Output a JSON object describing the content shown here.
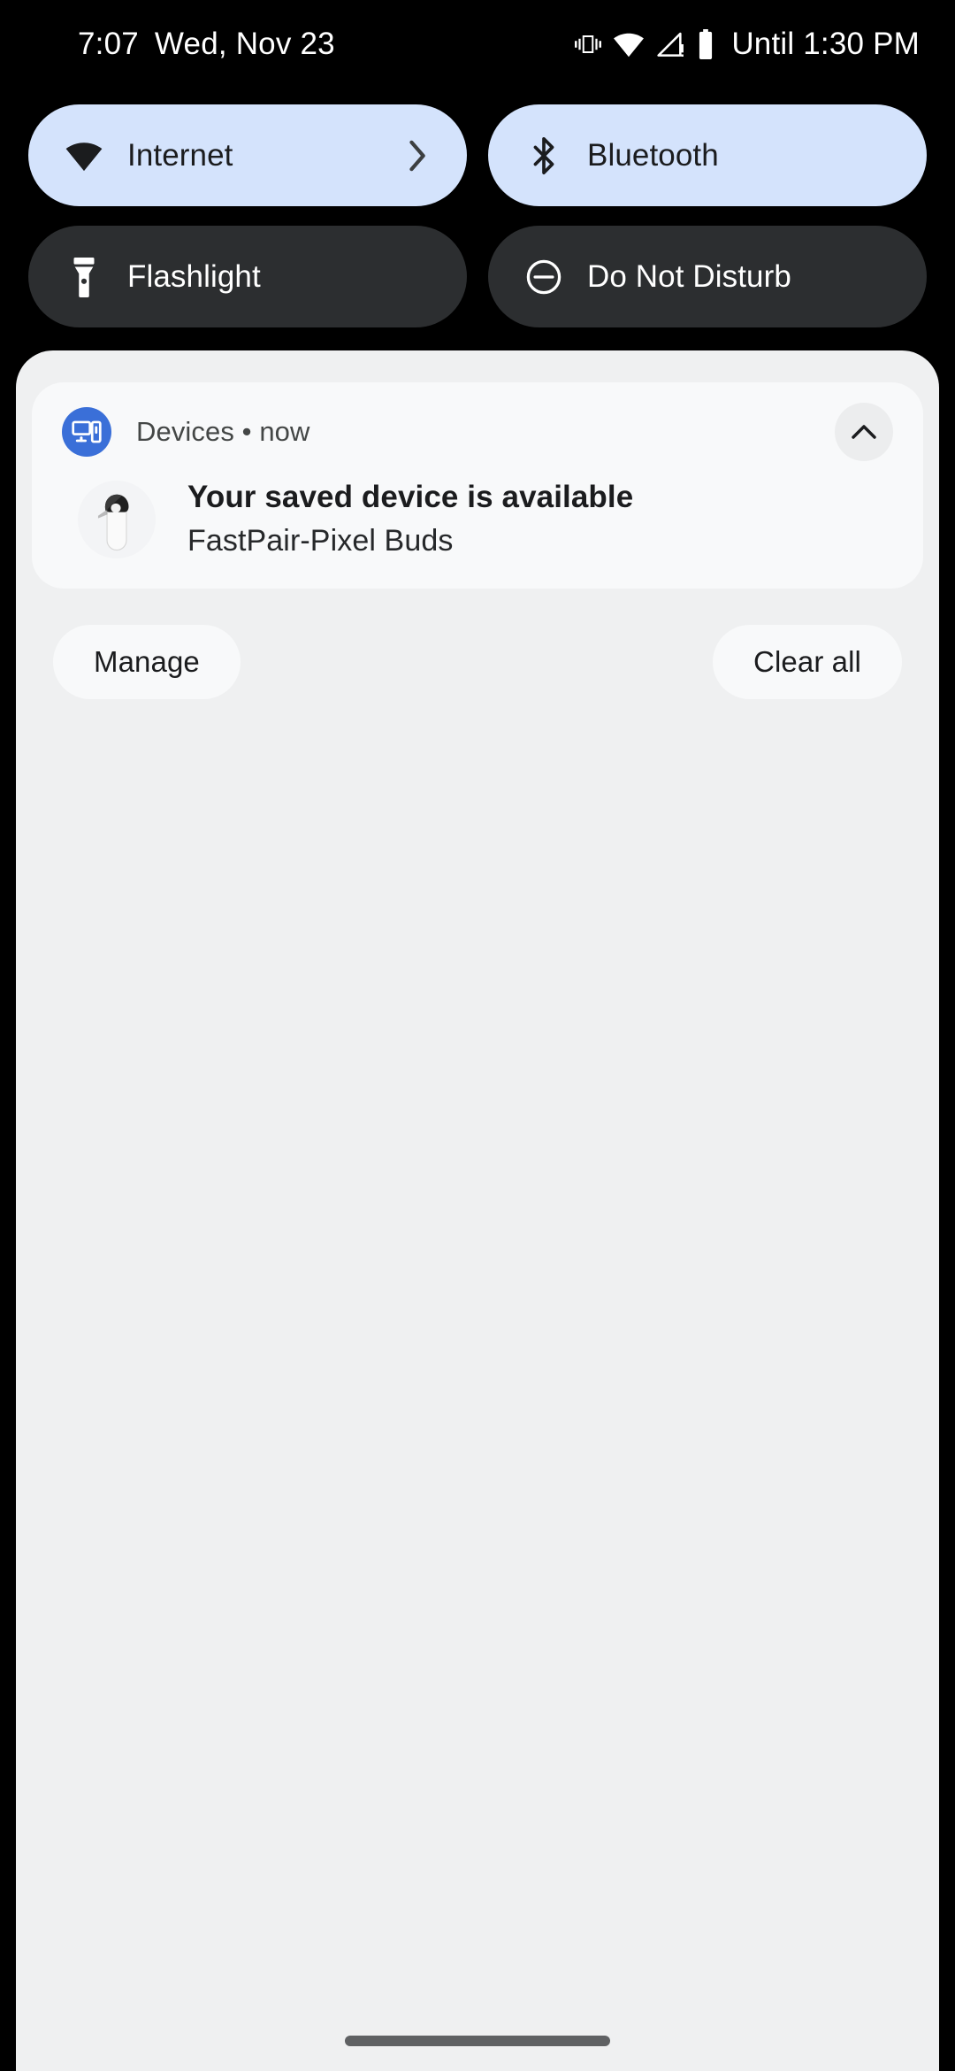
{
  "status_bar": {
    "time": "7:07",
    "date": "Wed, Nov 23",
    "icons": [
      "vibrate-icon",
      "wifi-icon",
      "signal-no-sim-icon",
      "battery-icon"
    ],
    "battery_text": "Until 1:30 PM"
  },
  "quick_settings": {
    "tiles": [
      {
        "label": "Internet",
        "icon": "wifi-icon",
        "state": "on",
        "has_chevron": true,
        "bg": "#D4E3FC",
        "fg": "#1B1C1E"
      },
      {
        "label": "Bluetooth",
        "icon": "bluetooth-icon",
        "state": "on",
        "has_chevron": false,
        "bg": "#D4E3FC",
        "fg": "#1B1C1E"
      },
      {
        "label": "Flashlight",
        "icon": "flashlight-icon",
        "state": "off",
        "has_chevron": false,
        "bg": "#2C2E30",
        "fg": "#FFFFFF"
      },
      {
        "label": "Do Not Disturb",
        "icon": "do-not-disturb-icon",
        "state": "off",
        "has_chevron": false,
        "bg": "#2C2E30",
        "fg": "#FFFFFF"
      }
    ]
  },
  "notification": {
    "app_name": "Devices",
    "separator": "•",
    "time": "now",
    "header_text": "Devices • now",
    "title": "Your saved device is available",
    "subtitle": "FastPair-Pixel Buds",
    "app_icon": "devices-icon",
    "device_image": "pixel-buds-case-image",
    "collapse_icon": "chevron-up-icon",
    "accent_color": "#3A6FD8"
  },
  "shade_actions": {
    "manage_label": "Manage",
    "clear_all_label": "Clear all"
  },
  "colors": {
    "background": "#000000",
    "shade_background": "#EFF0F1",
    "card_background": "#F8F9FA",
    "tile_on": "#D4E3FC",
    "tile_off": "#2C2E30",
    "nav_handle": "#5F6163"
  }
}
